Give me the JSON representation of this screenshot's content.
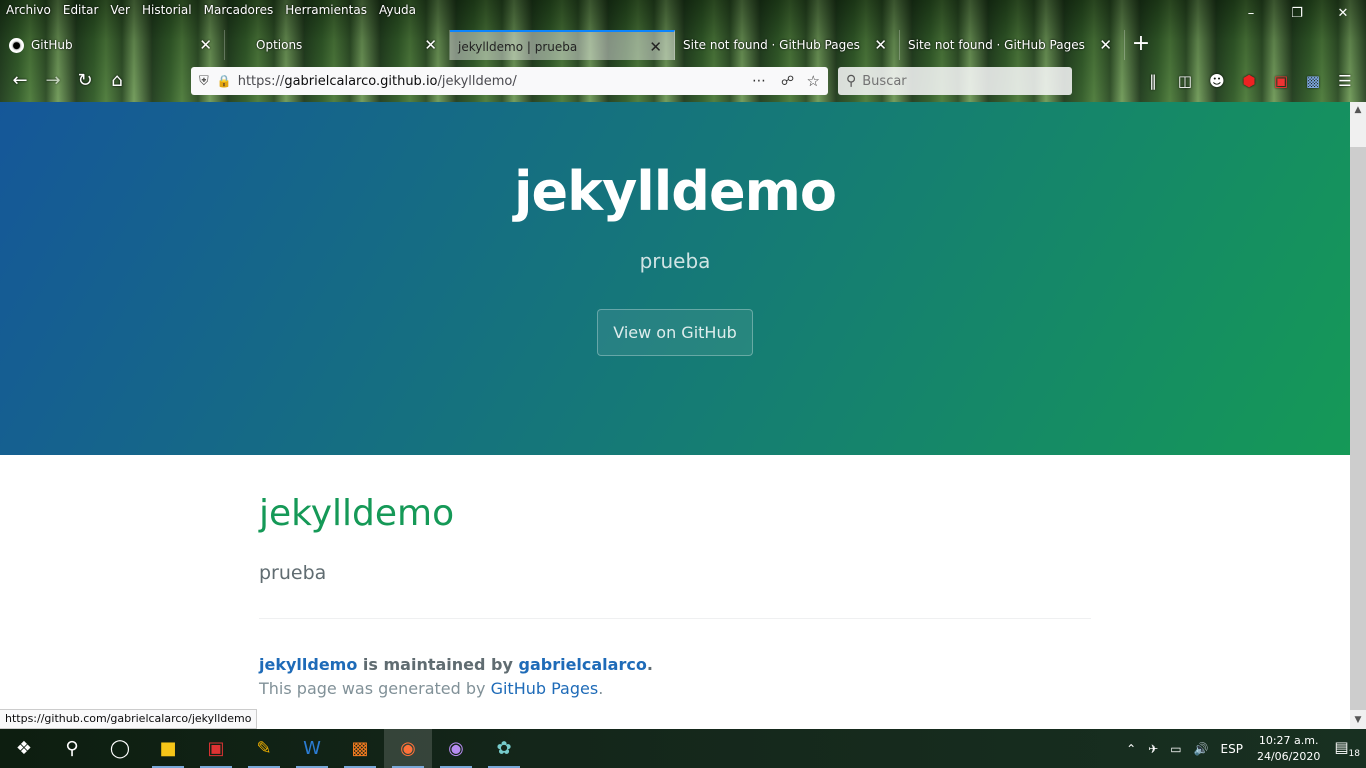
{
  "menubar": [
    "Archivo",
    "Editar",
    "Ver",
    "Historial",
    "Marcadores",
    "Herramientas",
    "Ayuda"
  ],
  "tabs": [
    {
      "title": "GitHub",
      "icon": "github-icon"
    },
    {
      "title": "Options"
    },
    {
      "title": "jekylldemo | prueba",
      "active": true
    },
    {
      "title": "Site not found · GitHub Pages"
    },
    {
      "title": "Site not found · GitHub Pages"
    }
  ],
  "urlbar": {
    "scheme": "https://",
    "host": "gabrielcalarco.github.io",
    "path": "/jekylldemo/"
  },
  "search": {
    "placeholder": "Buscar"
  },
  "hero": {
    "title": "jekylldemo",
    "subtitle": "prueba",
    "button": "View on GitHub"
  },
  "content": {
    "title": "jekylldemo",
    "lead": "prueba",
    "footer_project": "jekylldemo",
    "footer_maintained": " is maintained by ",
    "footer_owner": "gabrielcalarco",
    "footer_period": ".",
    "footer_generated": "This page was generated by ",
    "footer_gh_pages": "GitHub Pages",
    "footer_period2": "."
  },
  "status_url": "https://github.com/gabrielcalarco/jekylldemo",
  "tray": {
    "lang": "ESP",
    "time": "10:27 a.m.",
    "date": "24/06/2020",
    "notifications": "18"
  },
  "colors": {
    "hero_start": "#155799",
    "hero_end": "#159957",
    "link": "#1e6bb8",
    "heading": "#159957"
  }
}
